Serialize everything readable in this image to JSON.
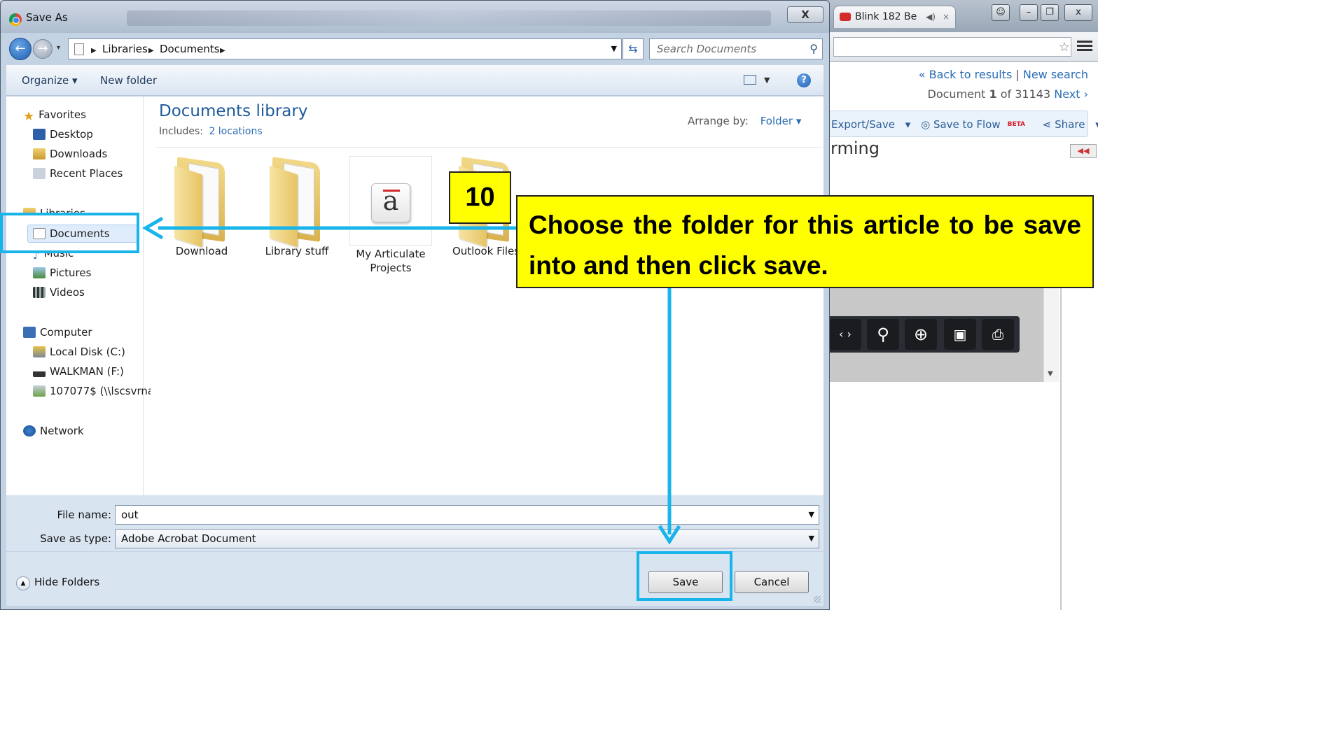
{
  "dialog": {
    "title": "Save As",
    "close_label": "X",
    "breadcrumb": [
      "Libraries",
      "Documents"
    ],
    "search_placeholder": "Search Documents",
    "toolbar": {
      "organize": "Organize",
      "new_folder": "New folder"
    },
    "nav": {
      "favorites_header": "Favorites",
      "favorites": [
        "Desktop",
        "Downloads",
        "Recent Places"
      ],
      "libraries_header": "Libraries",
      "libraries": [
        "Documents",
        "Music",
        "Pictures",
        "Videos"
      ],
      "computer_header": "Computer",
      "computer": [
        "Local Disk (C:)",
        "WALKMAN (F:)",
        "107077$ (\\\\lscsvrnas"
      ],
      "network_header": "Network"
    },
    "library": {
      "title": "Documents library",
      "includes_label": "Includes:",
      "includes_link": "2 locations",
      "arrange_label": "Arrange by:",
      "arrange_value": "Folder"
    },
    "items": [
      {
        "name": "Download",
        "icon": "folder-icon"
      },
      {
        "name": "Library stuff",
        "icon": "folder-icon"
      },
      {
        "name": "My Articulate Projects",
        "icon": "articulate-app-icon"
      },
      {
        "name": "Outlook Files",
        "icon": "folder-icon"
      }
    ],
    "fields": {
      "filename_label": "File name:",
      "filename_value": "out",
      "type_label": "Save as type:",
      "type_value": "Adobe Acrobat Document"
    },
    "hide_folders": "Hide Folders",
    "save": "Save",
    "cancel": "Cancel"
  },
  "browser": {
    "tab_title": "Blink 182 Be",
    "back_to_results": "« Back to results",
    "new_search": "New search",
    "doc_prefix": "Document",
    "doc_index": "1",
    "doc_of": "of 31143",
    "next": "Next ›",
    "export_save": "Export/Save",
    "save_to_flow": "Save to Flow",
    "beta": "BETA",
    "share": "Share",
    "heading_fragment": "rming"
  },
  "annotation": {
    "step": "10",
    "instruction": "Choose the folder for this article to be save into and then click save.",
    "accent_color": "#18b4ea",
    "callout_color": "#ffff00"
  }
}
